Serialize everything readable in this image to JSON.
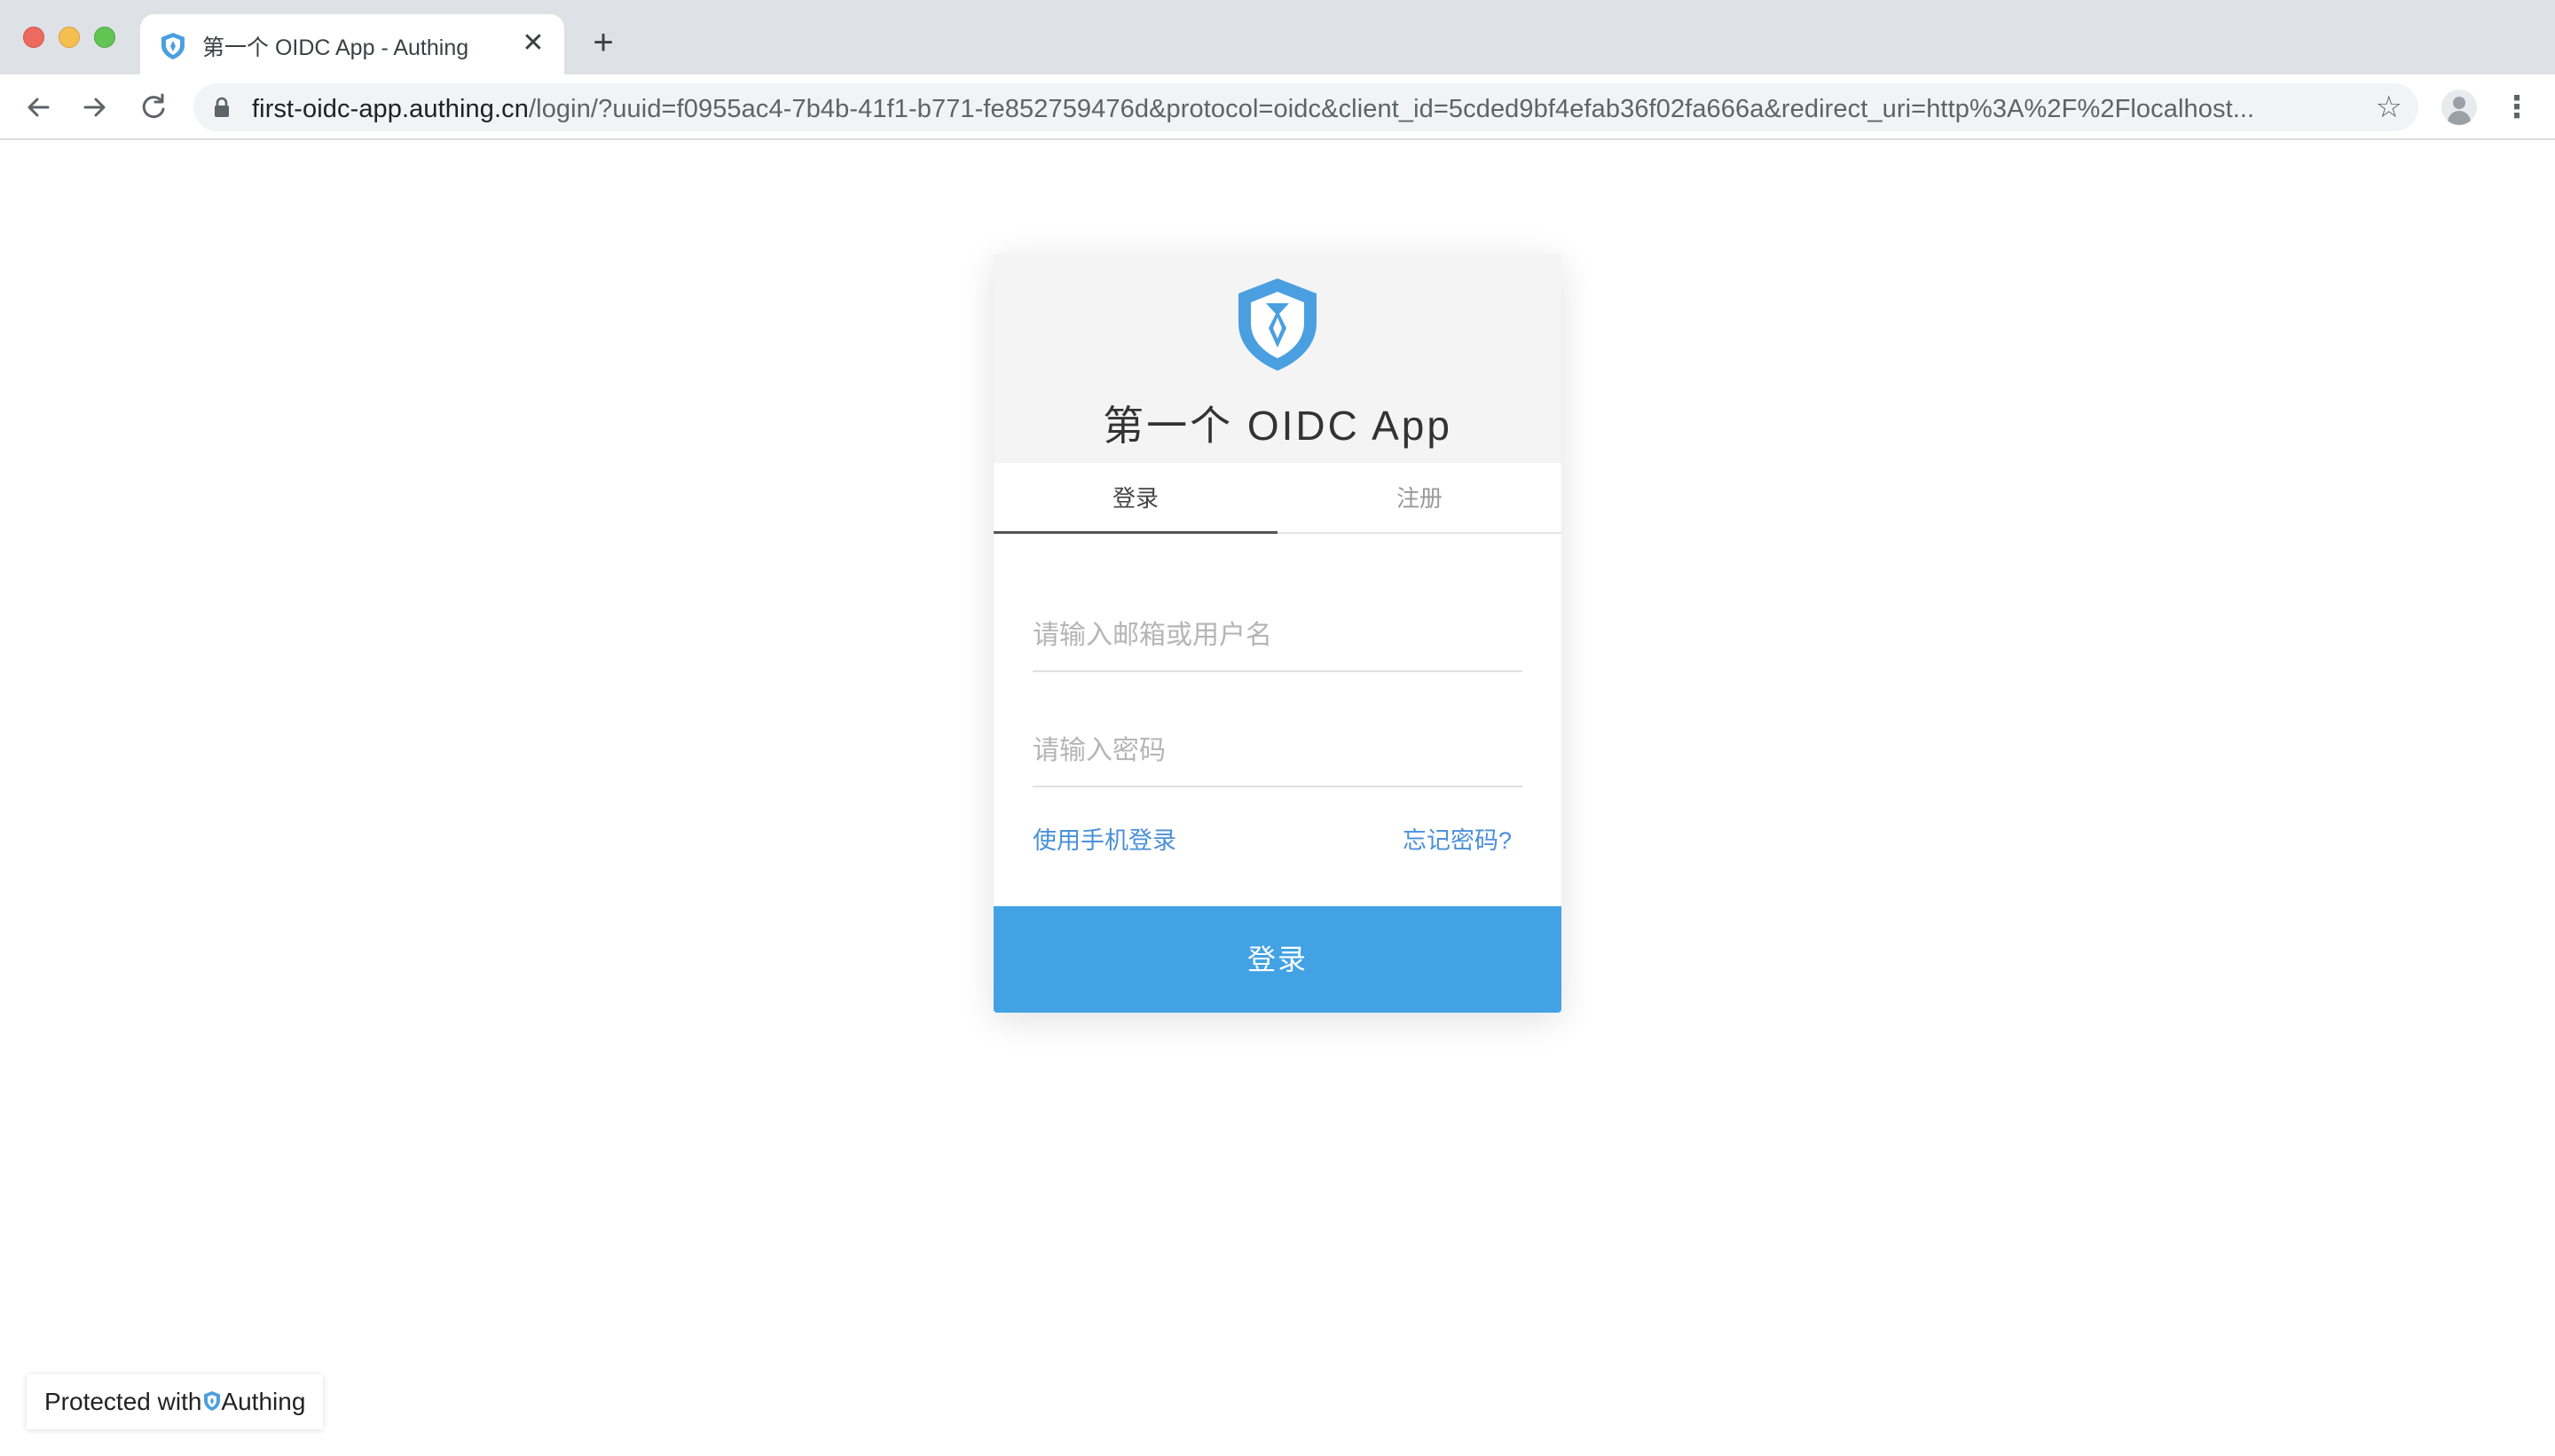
{
  "browser": {
    "tab_title": "第一个 OIDC App - Authing",
    "tab_close_glyph": "✕",
    "new_tab_glyph": "+",
    "url_host": "first-oidc-app.authing.cn",
    "url_path": "/login/?uuid=f0955ac4-7b4b-41f1-b771-fe852759476d&protocol=oidc&client_id=5cded9bf4efab36f02fa666a&redirect_uri=http%3A%2F%2Flocalhost...",
    "icons": {
      "back": "arrow-left-icon",
      "forward": "arrow-right-icon",
      "reload": "reload-icon",
      "lock": "lock-icon",
      "bookmark": "star-icon",
      "profile": "profile-icon",
      "menu": "more-vert-icon"
    }
  },
  "login": {
    "app_title": "第一个 OIDC App",
    "tabs": [
      {
        "label": "登录",
        "active": true
      },
      {
        "label": "注册",
        "active": false
      }
    ],
    "username_placeholder": "请输入邮箱或用户名",
    "password_placeholder": "请输入密码",
    "phone_login_link": "使用手机登录",
    "forgot_password_link": "忘记密码?",
    "submit_label": "登录"
  },
  "footer": {
    "protected_text": "Protected with",
    "brand": "Authing"
  },
  "colors": {
    "accent": "#42a2e3",
    "link": "#4a90d9",
    "shield": "#4a9fe0"
  }
}
